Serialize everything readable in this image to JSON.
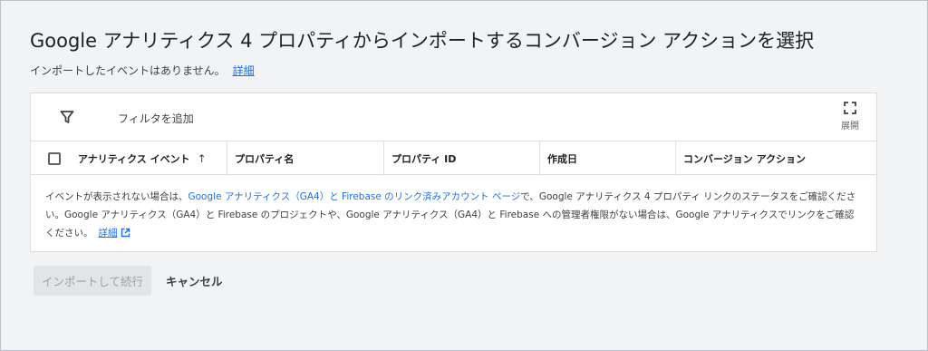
{
  "header": {
    "title": "Google アナリティクス 4 プロパティからインポートするコンバージョン アクションを選択",
    "subtitle": "インポートしたイベントはありません。",
    "subtitle_link": "詳細"
  },
  "filter_bar": {
    "filter_icon": "filter-icon",
    "add_filter_label": "フィルタを追加",
    "expand_icon": "fullscreen-icon",
    "expand_label": "展開"
  },
  "table": {
    "columns": [
      "アナリティクス イベント",
      "プロパティ名",
      "プロパティ ID",
      "作成日",
      "コンバージョン アクション"
    ],
    "sort_indicator": "↑"
  },
  "info": {
    "part1": "イベントが表示されない場合は、",
    "link1": "Google アナリティクス（GA4）と Firebase のリンク済みアカウント ページ",
    "part2": "で、Google アナリティクス 4 プロパティ リンクのステータスをご確認ください。Google アナリティクス（GA4）と Firebase のプロジェクトや、Google アナリティクス（GA4）と Firebase への管理者権限がない場合は、Google アナリティクスでリンクをご確認ください。",
    "learn_more": "詳細"
  },
  "actions": {
    "import_label": "インポートして続行",
    "cancel_label": "キャンセル"
  },
  "colors": {
    "link": "#1a73e8",
    "disabled_button_bg": "#e3e4e6",
    "disabled_button_text": "#9aa0a6"
  }
}
